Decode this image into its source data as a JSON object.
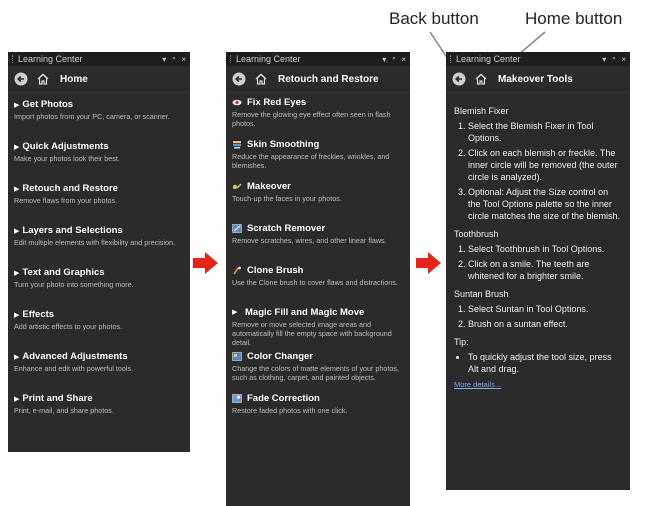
{
  "callouts": {
    "back": "Back button",
    "home": "Home button"
  },
  "panel_title": "Learning Center",
  "window_controls": {
    "dropdown": "▾",
    "pin": "ᐢ",
    "close": "×"
  },
  "panel1": {
    "title": "Home",
    "items": [
      {
        "label": "Get Photos",
        "desc": "Import photos from your PC, camera, or scanner."
      },
      {
        "label": "Quick Adjustments",
        "desc": "Make your photos look their best."
      },
      {
        "label": "Retouch and Restore",
        "desc": "Remove flaws from your photos."
      },
      {
        "label": "Layers and Selections",
        "desc": "Edit multiple elements with flexibility and precision."
      },
      {
        "label": "Text and Graphics",
        "desc": "Turn your photo into something more."
      },
      {
        "label": "Effects",
        "desc": "Add artistic effects to your photos."
      },
      {
        "label": "Advanced Adjustments",
        "desc": "Enhance and edit with powerful tools."
      },
      {
        "label": "Print and Share",
        "desc": "Print, e-mail, and share photos."
      }
    ]
  },
  "panel2": {
    "title": "Retouch and Restore",
    "items": [
      {
        "label": "Fix Red Eyes",
        "desc": "Remove the glowing eye effect often seen in flash photos.",
        "icon": "red-eye-icon"
      },
      {
        "label": "Skin Smoothing",
        "desc": "Reduce the appearance of freckles, wrinkles, and blemishes.",
        "icon": "skin-smoothing-icon"
      },
      {
        "label": "Makeover",
        "desc": "Touch-up the faces in your photos.",
        "icon": "makeover-icon"
      },
      {
        "label": "Scratch Remover",
        "desc": "Remove scratches, wires, and other linear flaws.",
        "icon": "scratch-remover-icon"
      },
      {
        "label": "Clone Brush",
        "desc": "Use the Clone brush to cover flaws and distractions.",
        "icon": "clone-brush-icon"
      },
      {
        "label": "Magic Fill and Magic Move",
        "desc": "Remove or move selected image areas and automatically fill the empty space with background detail.",
        "icon": "triangle"
      },
      {
        "label": "Color Changer",
        "desc": "Change the colors of matte elements of your photos, such as clothing, carpet, and painted objects.",
        "icon": "color-changer-icon"
      },
      {
        "label": "Fade Correction",
        "desc": "Restore faded photos with one click.",
        "icon": "fade-correction-icon"
      }
    ]
  },
  "panel3": {
    "title": "Makeover Tools",
    "blemish_heading": "Blemish Fixer",
    "blemish_steps": [
      "Select the Blemish Fixer in Tool Options.",
      "Click on each blemish or freckle. The inner circle will be removed (the outer circle is analyzed).",
      "Optional: Adjust the Size control on the Tool Options palette so the inner circle matches the size of the blemish."
    ],
    "toothbrush_heading": "Toothbrush",
    "toothbrush_steps": [
      "Select Toothbrush in Tool Options.",
      "Click on a smile. The teeth are whitened for a brighter smile."
    ],
    "suntan_heading": "Suntan Brush",
    "suntan_steps": [
      "Select Suntan in Tool Options.",
      "Brush on a suntan effect."
    ],
    "tip_heading": "Tip:",
    "tip_items": [
      "To quickly adjust the tool size, press Alt and drag."
    ],
    "more_link": "More details..."
  },
  "colors": {
    "panel_bg": "#2b2b2b",
    "arrow": "#e8231a"
  }
}
